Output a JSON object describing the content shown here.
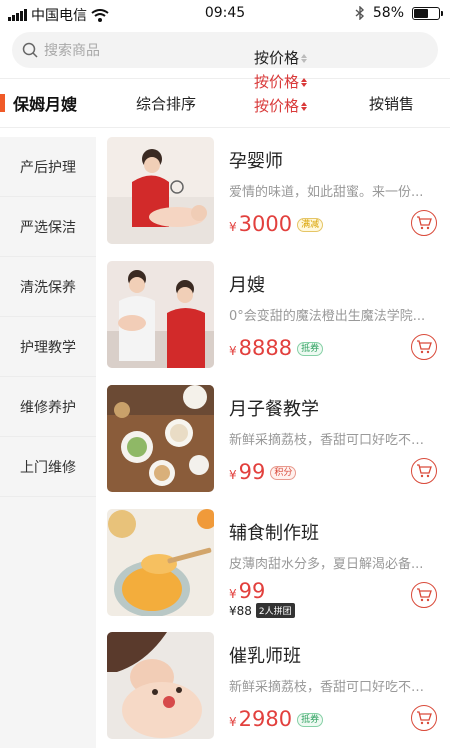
{
  "status_bar": {
    "carrier": "中国电信",
    "time": "09:45",
    "battery": "58%",
    "battery_level": 0.58
  },
  "search": {
    "placeholder": "搜索商品"
  },
  "sort_bar": {
    "category_title": "保姆月嫂",
    "sort_default": "综合排序",
    "sort_price": "按价格",
    "sort_sales": "按销售"
  },
  "sidebar": {
    "items": [
      {
        "label": "产后护理"
      },
      {
        "label": "严选保洁"
      },
      {
        "label": "清洗保养"
      },
      {
        "label": "护理教学"
      },
      {
        "label": "维修养护"
      },
      {
        "label": "上门维修"
      }
    ]
  },
  "products": [
    {
      "name": "孕婴师",
      "desc": "爱情的味道，如此甜蜜。来一份...",
      "currency": "¥",
      "price": "3000",
      "tag": "满减",
      "tag_color": "#d9a200"
    },
    {
      "name": "月嫂",
      "desc": "0°会变甜的魔法橙出生魔法学院...",
      "currency": "¥",
      "price": "8888",
      "tag": "抵券",
      "tag_color": "#2fa060"
    },
    {
      "name": "月子餐教学",
      "desc": "新鲜采摘荔枝，香甜可口好吃不上火",
      "currency": "¥",
      "price": "99",
      "tag": "积分",
      "tag_color": "#d94a3a"
    },
    {
      "name": "辅食制作班",
      "desc": "皮薄肉甜水分多，夏日解渴必备...",
      "currency": "¥",
      "price": "99",
      "original_price": "¥88",
      "group_tag": "2人拼团"
    },
    {
      "name": "催乳师班",
      "desc": "新鲜采摘荔枝，香甜可口好吃不上火",
      "currency": "¥",
      "price": "2980",
      "tag": "抵券",
      "tag_color": "#2fa060"
    }
  ],
  "colors": {
    "accent": "#f05a28",
    "price": "#e2403d"
  }
}
